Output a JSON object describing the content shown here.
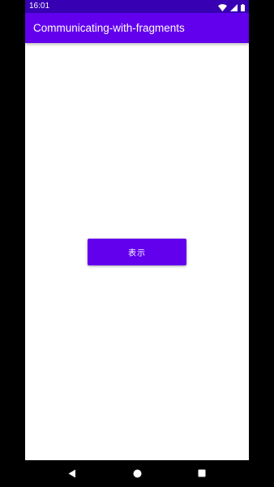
{
  "status_bar": {
    "time": "16:01",
    "icons": [
      "wifi-icon",
      "cellular-signal-icon",
      "battery-icon"
    ]
  },
  "app_bar": {
    "title": "Communicating-with-fragments"
  },
  "main": {
    "show_button_label": "表示"
  },
  "nav_bar": {
    "buttons": [
      "back-icon",
      "home-icon",
      "recents-icon"
    ]
  },
  "colors": {
    "primary": "#6200ee",
    "primary_dark": "#3700b3",
    "background": "#ffffff",
    "on_primary": "#ffffff"
  }
}
